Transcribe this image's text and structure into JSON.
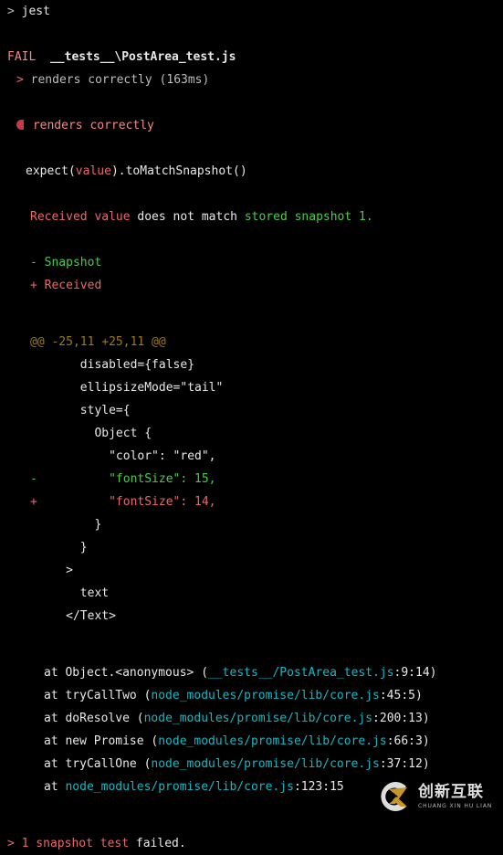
{
  "terminal": {
    "prompt_symbol": ">",
    "command": "jest",
    "status_label": "FAIL",
    "test_file": "__tests__\\PostArea_test.js",
    "test_name_with_time": "renders correctly (163ms)",
    "failed_test_name": "renders correctly",
    "assertion": {
      "prefix": "expect(",
      "received_arg": "value",
      "suffix": ").toMatchSnapshot()"
    },
    "mismatch": {
      "received_label": "Received value",
      "middle": " does not match ",
      "stored_label": "stored snapshot 1."
    },
    "legend": {
      "snapshot_marker": "-",
      "snapshot_label": "Snapshot",
      "received_marker": "+",
      "received_label": "Received"
    },
    "hunk_header": "@@ -25,11 +25,11 @@",
    "diff_lines": [
      {
        "marker": "",
        "text": "      disabled={false}",
        "kind": "context"
      },
      {
        "marker": "",
        "text": "      ellipsizeMode=\"tail\"",
        "kind": "context"
      },
      {
        "marker": "",
        "text": "      style={",
        "kind": "context"
      },
      {
        "marker": "",
        "text": "        Object {",
        "kind": "context"
      },
      {
        "marker": "",
        "text": "          \"color\": \"red\",",
        "kind": "context"
      },
      {
        "marker": "-",
        "text": "          \"fontSize\": 15,",
        "kind": "removed"
      },
      {
        "marker": "+",
        "text": "          \"fontSize\": 14,",
        "kind": "added"
      },
      {
        "marker": "",
        "text": "        }",
        "kind": "context"
      },
      {
        "marker": "",
        "text": "      }",
        "kind": "context"
      },
      {
        "marker": "",
        "text": "    >",
        "kind": "context"
      },
      {
        "marker": "",
        "text": "      text",
        "kind": "context"
      },
      {
        "marker": "",
        "text": "    </Text>",
        "kind": "context"
      }
    ],
    "stack_frames": [
      {
        "at": "at ",
        "fn": "Object.<anonymous> ",
        "open": "(",
        "path": "__tests__/PostArea_test.js",
        "loc": ":9:14",
        "close": ")"
      },
      {
        "at": "at ",
        "fn": "tryCallTwo ",
        "open": "(",
        "path": "node_modules/promise/lib/core.js",
        "loc": ":45:5",
        "close": ")"
      },
      {
        "at": "at ",
        "fn": "doResolve ",
        "open": "(",
        "path": "node_modules/promise/lib/core.js",
        "loc": ":200:13",
        "close": ")"
      },
      {
        "at": "at ",
        "fn": "new Promise ",
        "open": "(",
        "path": "node_modules/promise/lib/core.js",
        "loc": ":66:3",
        "close": ")"
      },
      {
        "at": "at ",
        "fn": "tryCallOne ",
        "open": "(",
        "path": "node_modules/promise/lib/core.js",
        "loc": ":37:12",
        "close": ")"
      },
      {
        "at": "at ",
        "fn": "",
        "open": "",
        "path": "node_modules/promise/lib/core.js",
        "loc": ":123:15",
        "close": ""
      }
    ],
    "summary": {
      "arrow": ">",
      "count_text": "1 snapshot test",
      "result_text": "failed."
    }
  },
  "watermark": {
    "chinese": "创新互联",
    "pinyin": "CHUANG XIN HU LIAN"
  },
  "colors": {
    "background": "#000000",
    "fail": "#f28b82",
    "added": "#e8696a",
    "removed": "#4ec94e",
    "path": "#14b8c4",
    "hunk": "#9c7a1a"
  }
}
